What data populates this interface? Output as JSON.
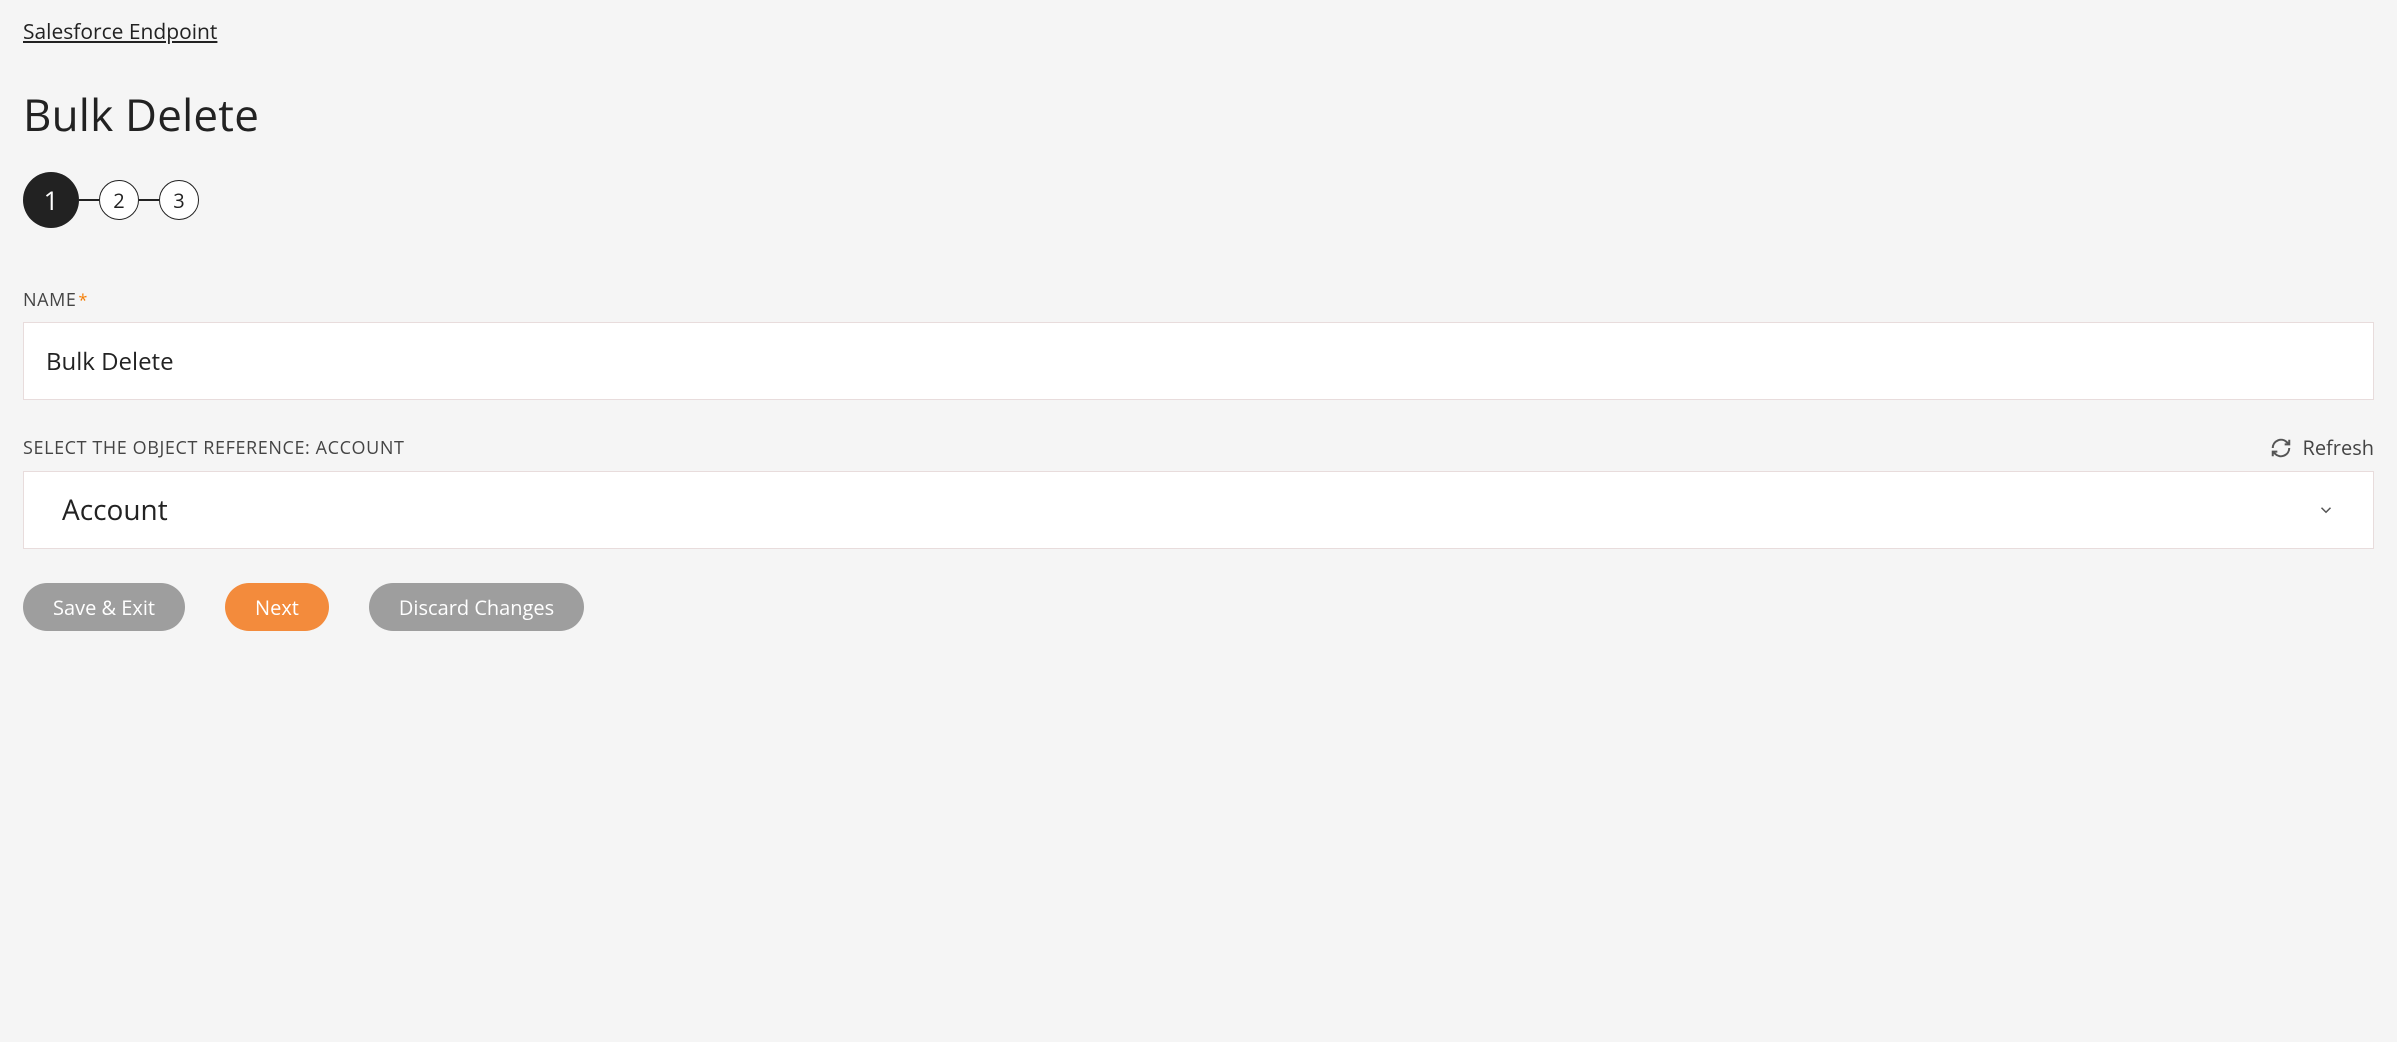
{
  "breadcrumb": "Salesforce Endpoint",
  "page_title": "Bulk Delete",
  "stepper": {
    "steps": [
      "1",
      "2",
      "3"
    ],
    "active_index": 0
  },
  "fields": {
    "name": {
      "label": "NAME",
      "required_marker": "*",
      "value": "Bulk Delete"
    },
    "object_ref": {
      "label": "SELECT THE OBJECT REFERENCE: ACCOUNT",
      "selected": "Account",
      "refresh_label": "Refresh"
    }
  },
  "buttons": {
    "save_exit": "Save & Exit",
    "next": "Next",
    "discard": "Discard Changes"
  }
}
